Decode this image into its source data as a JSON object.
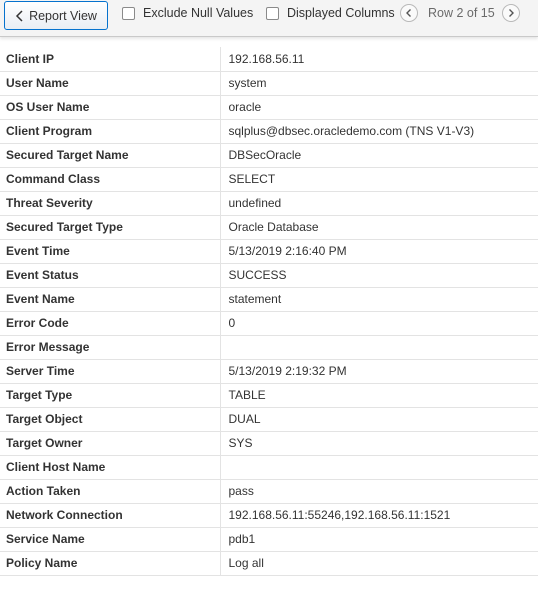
{
  "toolbar": {
    "report_view_label": "Report View",
    "exclude_null_label": "Exclude Null Values",
    "displayed_columns_label": "Displayed Columns",
    "row_indicator": "Row 2 of 15"
  },
  "details": [
    {
      "label": "Client IP",
      "value": "192.168.56.11"
    },
    {
      "label": "User Name",
      "value": "system"
    },
    {
      "label": "OS User Name",
      "value": "oracle"
    },
    {
      "label": "Client Program",
      "value": "sqlplus@dbsec.oracledemo.com (TNS V1-V3)"
    },
    {
      "label": "Secured Target Name",
      "value": "DBSecOracle"
    },
    {
      "label": "Command Class",
      "value": "SELECT"
    },
    {
      "label": "Threat Severity",
      "value": "undefined"
    },
    {
      "label": "Secured Target Type",
      "value": "Oracle Database"
    },
    {
      "label": "Event Time",
      "value": "5/13/2019 2:16:40 PM"
    },
    {
      "label": "Event Status",
      "value": "SUCCESS"
    },
    {
      "label": "Event Name",
      "value": "statement"
    },
    {
      "label": "Error Code",
      "value": "0"
    },
    {
      "label": "Error Message",
      "value": ""
    },
    {
      "label": "Server Time",
      "value": "5/13/2019 2:19:32 PM"
    },
    {
      "label": "Target Type",
      "value": "TABLE"
    },
    {
      "label": "Target Object",
      "value": "DUAL"
    },
    {
      "label": "Target Owner",
      "value": "SYS"
    },
    {
      "label": "Client Host Name",
      "value": ""
    },
    {
      "label": "Action Taken",
      "value": "pass"
    },
    {
      "label": "Network Connection",
      "value": "192.168.56.11:55246,192.168.56.11:1521"
    },
    {
      "label": "Service Name",
      "value": "pdb1"
    },
    {
      "label": "Policy Name",
      "value": "Log all"
    }
  ]
}
